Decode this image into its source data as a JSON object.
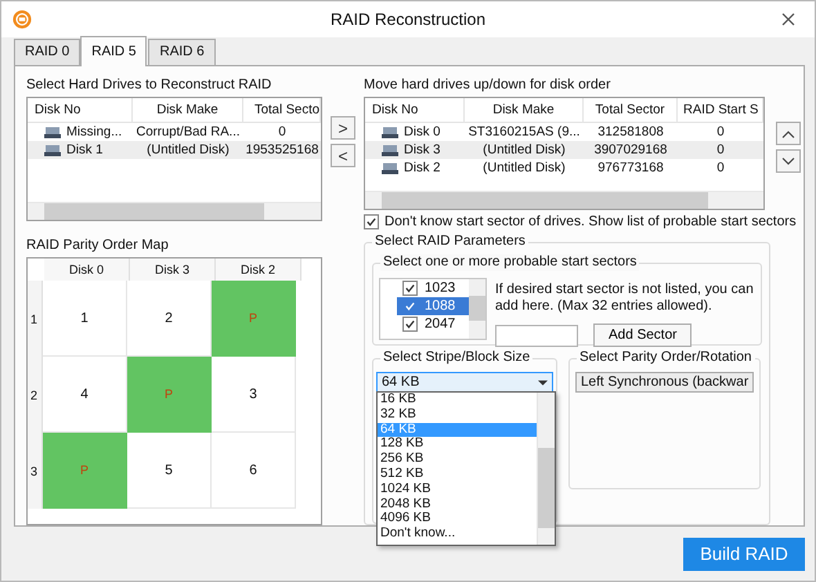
{
  "window": {
    "title": "RAID Reconstruction"
  },
  "tabs": [
    {
      "label": "RAID 0",
      "selected": false
    },
    {
      "label": "RAID 5",
      "selected": true
    },
    {
      "label": "RAID 6",
      "selected": false
    }
  ],
  "source_drives": {
    "label": "Select Hard Drives to Reconstruct RAID",
    "columns": [
      "Disk No",
      "Disk Make",
      "Total Secto"
    ],
    "rows": [
      {
        "disk_no": "Missing...",
        "disk_make": "Corrupt/Bad RA...",
        "total_sector": "0",
        "selected": false
      },
      {
        "disk_no": "Disk 1",
        "disk_make": "(Untitled Disk)",
        "total_sector": "1953525168",
        "selected": true
      }
    ]
  },
  "move_buttons": [
    ">",
    "<"
  ],
  "ordered_drives": {
    "label": "Move hard drives up/down for disk order",
    "columns": [
      "Disk No",
      "Disk Make",
      "Total Sector",
      "RAID Start S"
    ],
    "rows": [
      {
        "disk_no": "Disk 0",
        "disk_make": "ST3160215AS (9...",
        "total_sector": "312581808",
        "start_sector": "0",
        "selected": false
      },
      {
        "disk_no": "Disk 3",
        "disk_make": "(Untitled Disk)",
        "total_sector": "3907029168",
        "start_sector": "0",
        "selected": true
      },
      {
        "disk_no": "Disk 2",
        "disk_make": "(Untitled Disk)",
        "total_sector": "976773168",
        "start_sector": "0",
        "selected": false
      }
    ]
  },
  "unknown_start_sector": {
    "label": "Don't know start sector of drives. Show list of probable start sectors",
    "checked": true
  },
  "parity_map": {
    "label": "RAID Parity Order Map",
    "columns": [
      "Disk 0",
      "Disk 3",
      "Disk 2"
    ],
    "rows": [
      {
        "label": "1",
        "cells": [
          {
            "text": "1",
            "parity": false
          },
          {
            "text": "2",
            "parity": false
          },
          {
            "text": "P",
            "parity": true
          }
        ]
      },
      {
        "label": "2",
        "cells": [
          {
            "text": "4",
            "parity": false
          },
          {
            "text": "P",
            "parity": true
          },
          {
            "text": "3",
            "parity": false
          }
        ]
      },
      {
        "label": "3",
        "cells": [
          {
            "text": "P",
            "parity": true
          },
          {
            "text": "5",
            "parity": false
          },
          {
            "text": "6",
            "parity": false
          }
        ]
      }
    ]
  },
  "parameters": {
    "label": "Select RAID Parameters",
    "sectors": {
      "label": "Select one or more probable start sectors",
      "items": [
        {
          "value": "1023",
          "checked": true,
          "selected": false
        },
        {
          "value": "1088",
          "checked": true,
          "selected": true
        },
        {
          "value": "2047",
          "checked": true,
          "selected": false
        }
      ],
      "hint": "If desired start sector is not listed, you can add here. (Max 32 entries allowed).",
      "add_button": "Add Sector"
    },
    "stripe": {
      "label": "Select Stripe/Block Size",
      "value": "64 KB",
      "expanded": true,
      "options": [
        {
          "label": "16 KB",
          "selected": false
        },
        {
          "label": "32 KB",
          "selected": false
        },
        {
          "label": "64 KB",
          "selected": true
        },
        {
          "label": "128 KB",
          "selected": false
        },
        {
          "label": "256 KB",
          "selected": false
        },
        {
          "label": "512 KB",
          "selected": false
        },
        {
          "label": "1024 KB",
          "selected": false
        },
        {
          "label": "2048 KB",
          "selected": false
        },
        {
          "label": "4096 KB",
          "selected": false
        },
        {
          "label": "Don't know...",
          "selected": false
        }
      ]
    },
    "parity_rotation": {
      "label": "Select Parity Order/Rotation",
      "value": "Left Synchronous (backwar"
    }
  },
  "build_button": "Build RAID"
}
